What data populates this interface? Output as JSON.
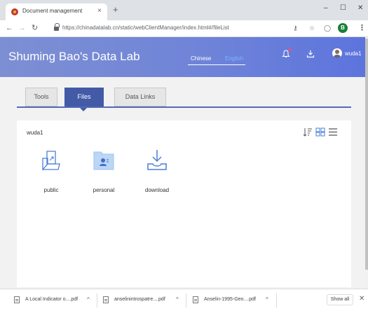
{
  "browser": {
    "tab_title": "Document management",
    "tab_close": "×",
    "new_tab": "+",
    "window_controls": {
      "minimize": "–",
      "maximize": "☐",
      "close": "✕"
    },
    "url": "https://chinadatalab.cn/static/webClientManager/index.html#/fileList",
    "profile_initial": "B",
    "icons": [
      "back-arrow-icon",
      "forward-arrow-icon",
      "reload-icon",
      "lock-icon",
      "key-icon",
      "star-icon",
      "circle-icon",
      "menu-icon"
    ]
  },
  "header": {
    "title": "Shuming Bao's Data Lab",
    "languages": [
      "Chinese",
      "English"
    ],
    "active_language": "Chinese",
    "username": "wuda1",
    "colors": {
      "gradient_start": "#7d8fd3",
      "gradient_end": "#5d74dd",
      "english_link": "#7fb4ff",
      "notification_dot": "#ff4d6d"
    }
  },
  "main": {
    "tabs": [
      {
        "label": "Tools",
        "active": false
      },
      {
        "label": "Files",
        "active": true
      },
      {
        "label": "Data Links",
        "active": false
      }
    ],
    "accent_color": "#435aa6",
    "breadcrumb": "wuda1",
    "view_controls": [
      "sort-icon",
      "grid-view-icon",
      "list-view-icon"
    ],
    "files": [
      {
        "name": "public",
        "icon": "share-folder-icon"
      },
      {
        "name": "personal",
        "icon": "personal-folder-icon"
      },
      {
        "name": "download",
        "icon": "download-tray-icon"
      }
    ]
  },
  "downloads": {
    "items": [
      {
        "name": "A Local Indicator o....pdf"
      },
      {
        "name": "anselinintrospatre....pdf"
      },
      {
        "name": "Anselin-1995-Geo....pdf"
      }
    ],
    "show_all": "Show all",
    "close": "✕"
  }
}
